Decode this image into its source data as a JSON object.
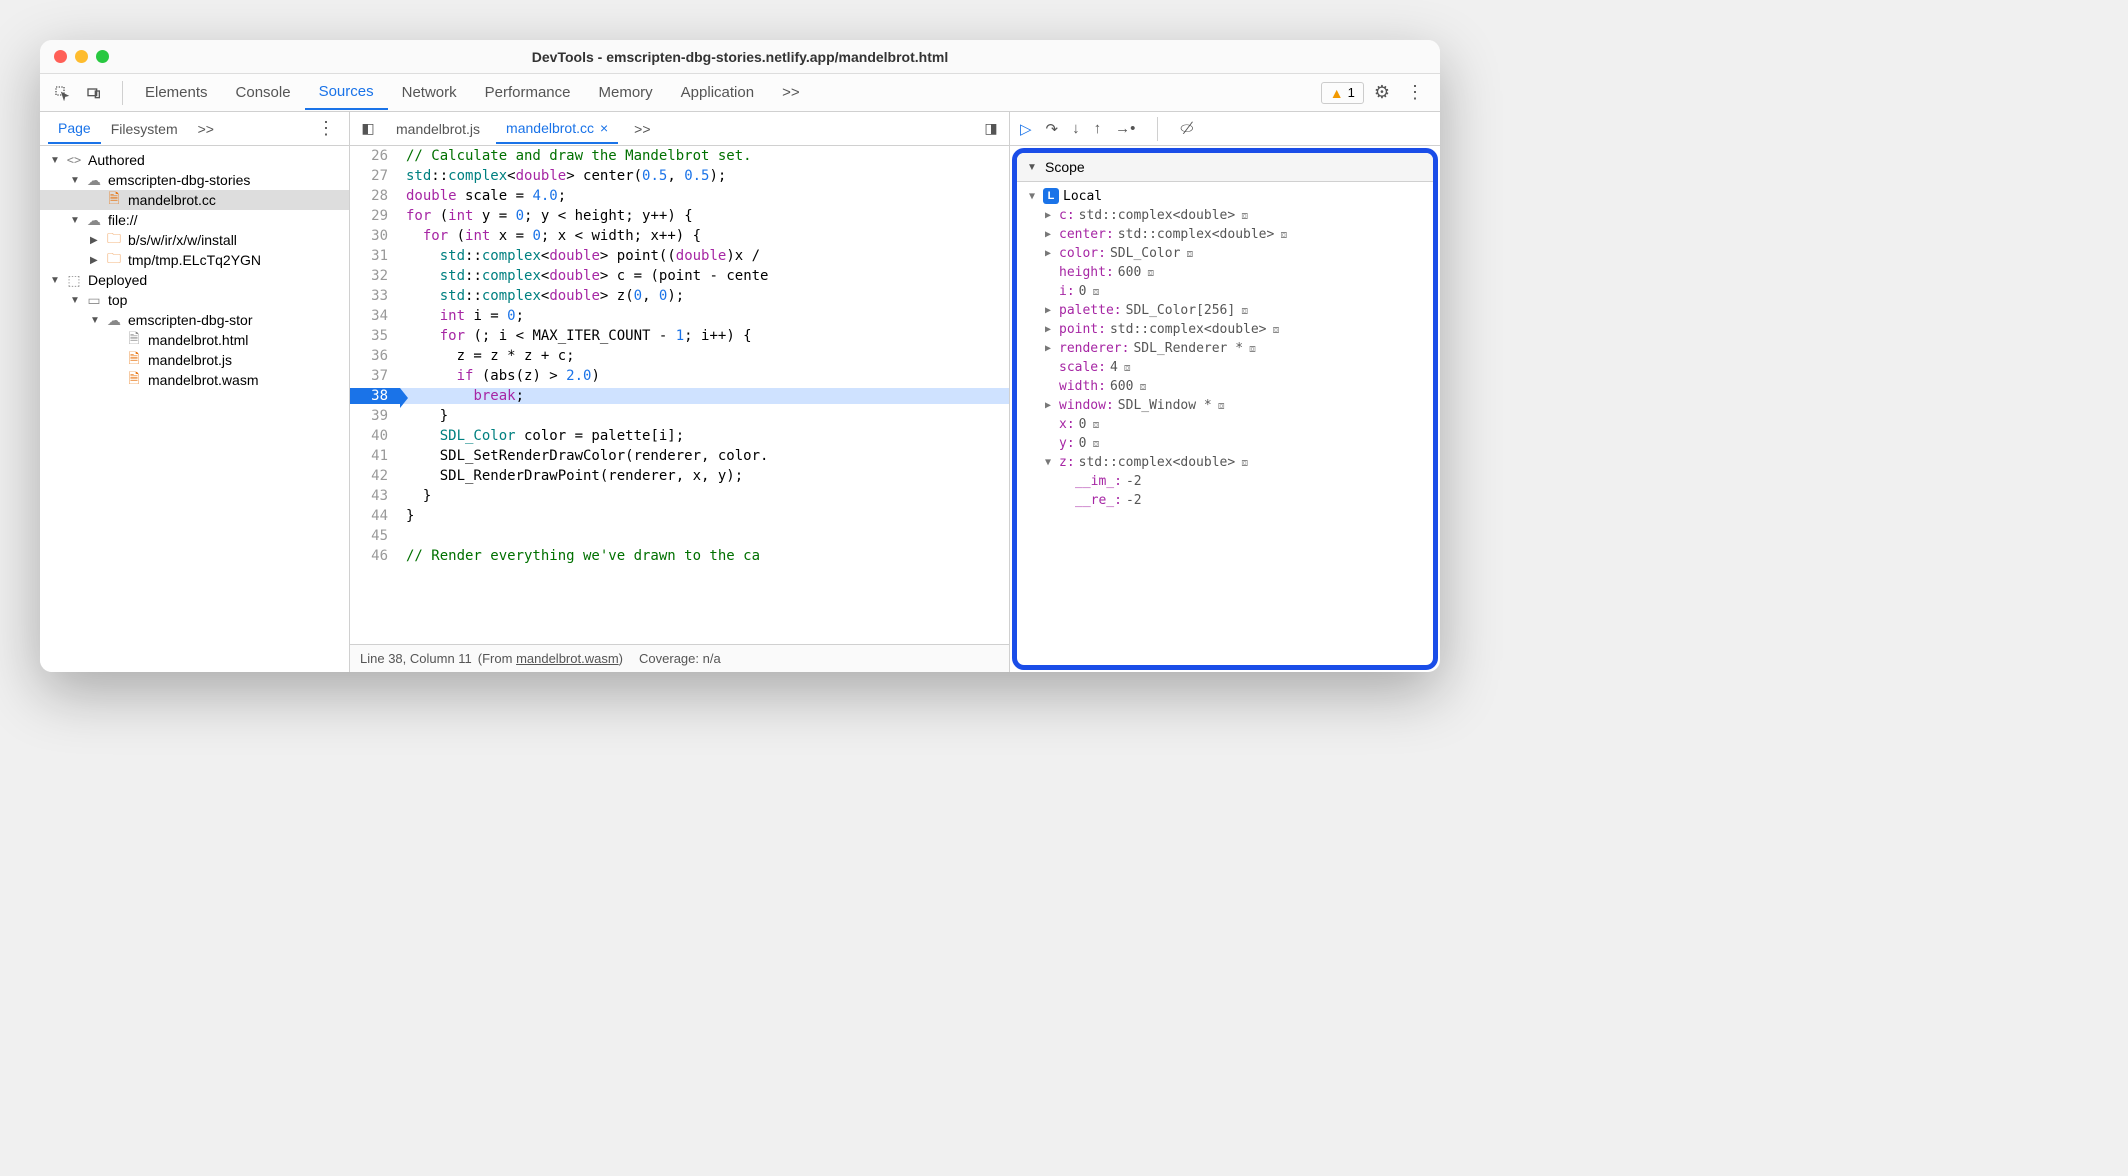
{
  "window": {
    "title": "DevTools - emscripten-dbg-stories.netlify.app/mandelbrot.html"
  },
  "toolbar": {
    "tabs": [
      "Elements",
      "Console",
      "Sources",
      "Network",
      "Performance",
      "Memory",
      "Application"
    ],
    "active_tab": "Sources",
    "overflow": ">>",
    "warning_count": "1"
  },
  "sidebar": {
    "tabs": [
      "Page",
      "Filesystem"
    ],
    "active": "Page",
    "overflow": ">>",
    "tree": {
      "authored": "Authored",
      "authored_domain": "emscripten-dbg-stories",
      "authored_file": "mandelbrot.cc",
      "file_proto": "file://",
      "file_dir1": "b/s/w/ir/x/w/install",
      "file_dir2": "tmp/tmp.ELcTq2YGN",
      "deployed": "Deployed",
      "top": "top",
      "deploy_domain": "emscripten-dbg-stor",
      "deploy_f1": "mandelbrot.html",
      "deploy_f2": "mandelbrot.js",
      "deploy_f3": "mandelbrot.wasm"
    }
  },
  "editor": {
    "tabs": {
      "t1": "mandelbrot.js",
      "t2": "mandelbrot.cc",
      "overflow": ">>"
    },
    "lines": [
      {
        "n": "26",
        "html": "<span class='c-com'>// Calculate and draw the Mandelbrot set.</span>"
      },
      {
        "n": "27",
        "html": "<span class='c-type'>std</span>::<span class='c-type'>complex</span>&lt;<span class='c-kw'>double</span>&gt; center(<span class='c-num'>0.5</span>, <span class='c-num'>0.5</span>);"
      },
      {
        "n": "28",
        "html": "<span class='c-kw'>double</span> scale = <span class='c-num'>4.0</span>;"
      },
      {
        "n": "29",
        "html": "<span class='c-kw'>for</span> (<span class='c-kw'>int</span> y = <span class='c-num'>0</span>; y &lt; height; y++) {"
      },
      {
        "n": "30",
        "html": "  <span class='c-kw'>for</span> (<span class='c-kw'>int</span> x = <span class='c-num'>0</span>; x &lt; width; x++) {"
      },
      {
        "n": "31",
        "html": "    <span class='c-type'>std</span>::<span class='c-type'>complex</span>&lt;<span class='c-kw'>double</span>&gt; point((<span class='c-kw'>double</span>)x /"
      },
      {
        "n": "32",
        "html": "    <span class='c-type'>std</span>::<span class='c-type'>complex</span>&lt;<span class='c-kw'>double</span>&gt; c = (point - cente"
      },
      {
        "n": "33",
        "html": "    <span class='c-type'>std</span>::<span class='c-type'>complex</span>&lt;<span class='c-kw'>double</span>&gt; z(<span class='c-num'>0</span>, <span class='c-num'>0</span>);"
      },
      {
        "n": "34",
        "html": "    <span class='c-kw'>int</span> i = <span class='c-num'>0</span>;"
      },
      {
        "n": "35",
        "html": "    <span class='c-kw'>for</span> (; i &lt; MAX_ITER_COUNT - <span class='c-num'>1</span>; i++) {"
      },
      {
        "n": "36",
        "html": "      z = z * z + c;"
      },
      {
        "n": "37",
        "html": "      <span class='c-kw'>if</span> (abs(z) &gt; <span class='c-num'>2.0</span>)"
      },
      {
        "n": "38",
        "html": "        <span class='c-kw'>break</span>;",
        "current": true
      },
      {
        "n": "39",
        "html": "    }"
      },
      {
        "n": "40",
        "html": "    <span class='c-type'>SDL_Color</span> color = palette[i];"
      },
      {
        "n": "41",
        "html": "    SDL_SetRenderDrawColor(renderer, color."
      },
      {
        "n": "42",
        "html": "    SDL_RenderDrawPoint(renderer, x, y);"
      },
      {
        "n": "43",
        "html": "  }"
      },
      {
        "n": "44",
        "html": "}"
      },
      {
        "n": "45",
        "html": ""
      },
      {
        "n": "46",
        "html": "<span class='c-com'>// Render everything we've drawn to the ca</span>"
      }
    ]
  },
  "statusbar": {
    "position": "Line 38, Column 11",
    "from_prefix": "(From ",
    "from_file": "mandelbrot.wasm",
    "from_suffix": ")",
    "coverage": "Coverage: n/a"
  },
  "scope": {
    "title": "Scope",
    "local_label": "Local",
    "vars": [
      {
        "expand": "▶",
        "name": "c",
        "val": "std::complex<double>",
        "mem": true,
        "indent": 2
      },
      {
        "expand": "▶",
        "name": "center",
        "val": "std::complex<double>",
        "mem": true,
        "indent": 2
      },
      {
        "expand": "▶",
        "name": "color",
        "val": "SDL_Color",
        "mem": true,
        "indent": 2
      },
      {
        "expand": "",
        "name": "height",
        "val": "600",
        "mem": true,
        "indent": 2
      },
      {
        "expand": "",
        "name": "i",
        "val": "0",
        "mem": true,
        "indent": 2
      },
      {
        "expand": "▶",
        "name": "palette",
        "val": "SDL_Color[256]",
        "mem": true,
        "indent": 2
      },
      {
        "expand": "▶",
        "name": "point",
        "val": "std::complex<double>",
        "mem": true,
        "indent": 2
      },
      {
        "expand": "▶",
        "name": "renderer",
        "val": "SDL_Renderer *",
        "mem": true,
        "indent": 2
      },
      {
        "expand": "",
        "name": "scale",
        "val": "4",
        "mem": true,
        "indent": 2
      },
      {
        "expand": "",
        "name": "width",
        "val": "600",
        "mem": true,
        "indent": 2
      },
      {
        "expand": "▶",
        "name": "window",
        "val": "SDL_Window *",
        "mem": true,
        "indent": 2
      },
      {
        "expand": "",
        "name": "x",
        "val": "0",
        "mem": true,
        "indent": 2
      },
      {
        "expand": "",
        "name": "y",
        "val": "0",
        "mem": true,
        "indent": 2
      },
      {
        "expand": "▼",
        "name": "z",
        "val": "std::complex<double>",
        "mem": true,
        "indent": 2
      },
      {
        "expand": "",
        "name": "__im_",
        "val": "-2",
        "mem": false,
        "indent": 3
      },
      {
        "expand": "",
        "name": "__re_",
        "val": "-2",
        "mem": false,
        "indent": 3
      }
    ]
  }
}
